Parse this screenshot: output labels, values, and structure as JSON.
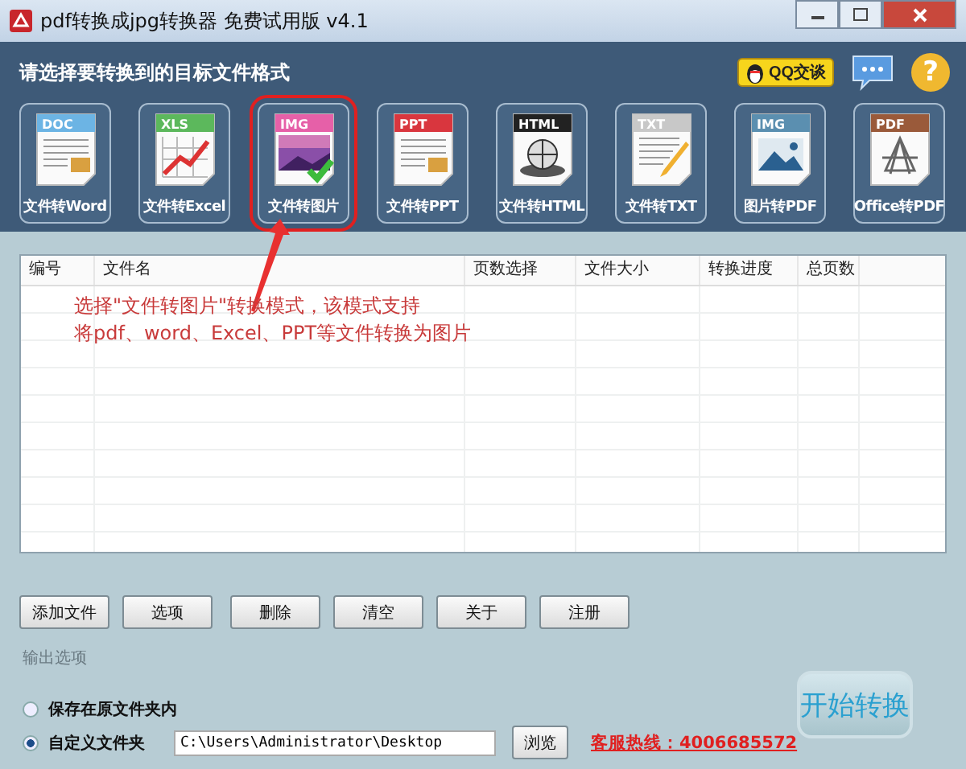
{
  "window": {
    "title": "pdf转换成jpg转换器 免费试用版 v4.1"
  },
  "header": {
    "heading": "请选择要转换到的目标文件格式",
    "qq_badge": "QQ交谈",
    "help": "?"
  },
  "formats": [
    {
      "label": "文件转Word",
      "tag": "DOC",
      "color": "#6cb4e4",
      "kind": "document",
      "selected": false
    },
    {
      "label": "文件转Excel",
      "tag": "XLS",
      "color": "#5cb85c",
      "kind": "chart",
      "selected": false
    },
    {
      "label": "文件转图片",
      "tag": "IMG",
      "color": "#e660a8",
      "kind": "photo",
      "selected": true
    },
    {
      "label": "文件转PPT",
      "tag": "PPT",
      "color": "#d9363e",
      "kind": "document",
      "selected": false
    },
    {
      "label": "文件转HTML",
      "tag": "HTML",
      "color": "#222222",
      "kind": "globe",
      "selected": false
    },
    {
      "label": "文件转TXT",
      "tag": "TXT",
      "color": "#c8c8c8",
      "kind": "pencil",
      "selected": false
    },
    {
      "label": "图片转PDF",
      "tag": "IMG",
      "color": "#5b8fb0",
      "kind": "landscape",
      "selected": false
    },
    {
      "label": "Office转PDF",
      "tag": "PDF",
      "color": "#9a5a3a",
      "kind": "pdf",
      "selected": false
    }
  ],
  "annotation": {
    "lines": [
      "选择\"文件转图片\"转换模式，该模式支持",
      "将pdf、word、Excel、PPT等文件转换为图片"
    ]
  },
  "table": {
    "columns": [
      "编号",
      "文件名",
      "页数选择",
      "文件大小",
      "转换进度",
      "总页数"
    ]
  },
  "buttons": [
    "添加文件",
    "选项",
    "删除",
    "清空",
    "关于",
    "注册"
  ],
  "output": {
    "heading": "输出选项",
    "options": [
      {
        "label": "保存在原文件夹内",
        "selected": false
      },
      {
        "label": "自定义文件夹",
        "selected": true
      }
    ],
    "path": "C:\\Users\\Administrator\\Desktop",
    "browse": "浏览",
    "hotline": "客服热线：4006685572"
  },
  "start_button": "开始转换"
}
